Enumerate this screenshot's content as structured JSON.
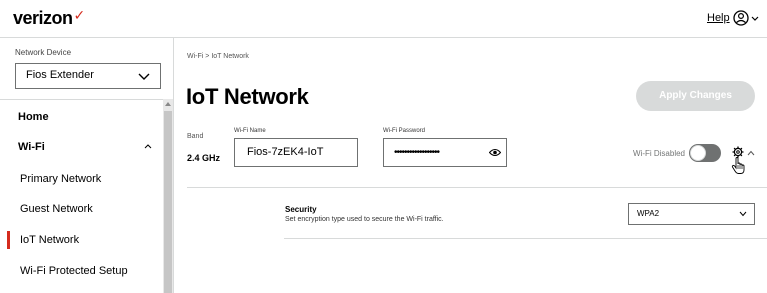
{
  "header": {
    "brand": "verizon",
    "brand_mark": "✓",
    "help_label": "Help",
    "user_icon": "user-circle-icon"
  },
  "sidebar": {
    "device_label": "Network Device",
    "device_value": "Fios Extender",
    "items": [
      {
        "label": "Home"
      },
      {
        "label": "Wi-Fi"
      },
      {
        "label": "Primary Network"
      },
      {
        "label": "Guest Network"
      },
      {
        "label": "IoT Network"
      },
      {
        "label": "Wi-Fi Protected Setup"
      }
    ]
  },
  "breadcrumb": {
    "parent": "Wi-Fi",
    "separator": ">",
    "current": "IoT Network"
  },
  "page": {
    "title": "IoT Network",
    "apply_label": "Apply Changes"
  },
  "band": {
    "label": "Band",
    "value": "2.4 GHz"
  },
  "wifi_name": {
    "label": "Wi-Fi Name",
    "value": "Fios-7zEK4-IoT"
  },
  "wifi_password": {
    "label": "Wi-Fi Password",
    "value": "••••••••••••••••••"
  },
  "wifi_toggle": {
    "label": "Wi-Fi Disabled",
    "enabled": false
  },
  "security": {
    "title": "Security",
    "description": "Set encryption type used to secure the Wi-Fi traffic.",
    "value": "WPA2"
  },
  "colors": {
    "accent": "#d52b1e",
    "disabled_button": "#d8dada",
    "toggle_off": "#6f7171"
  }
}
